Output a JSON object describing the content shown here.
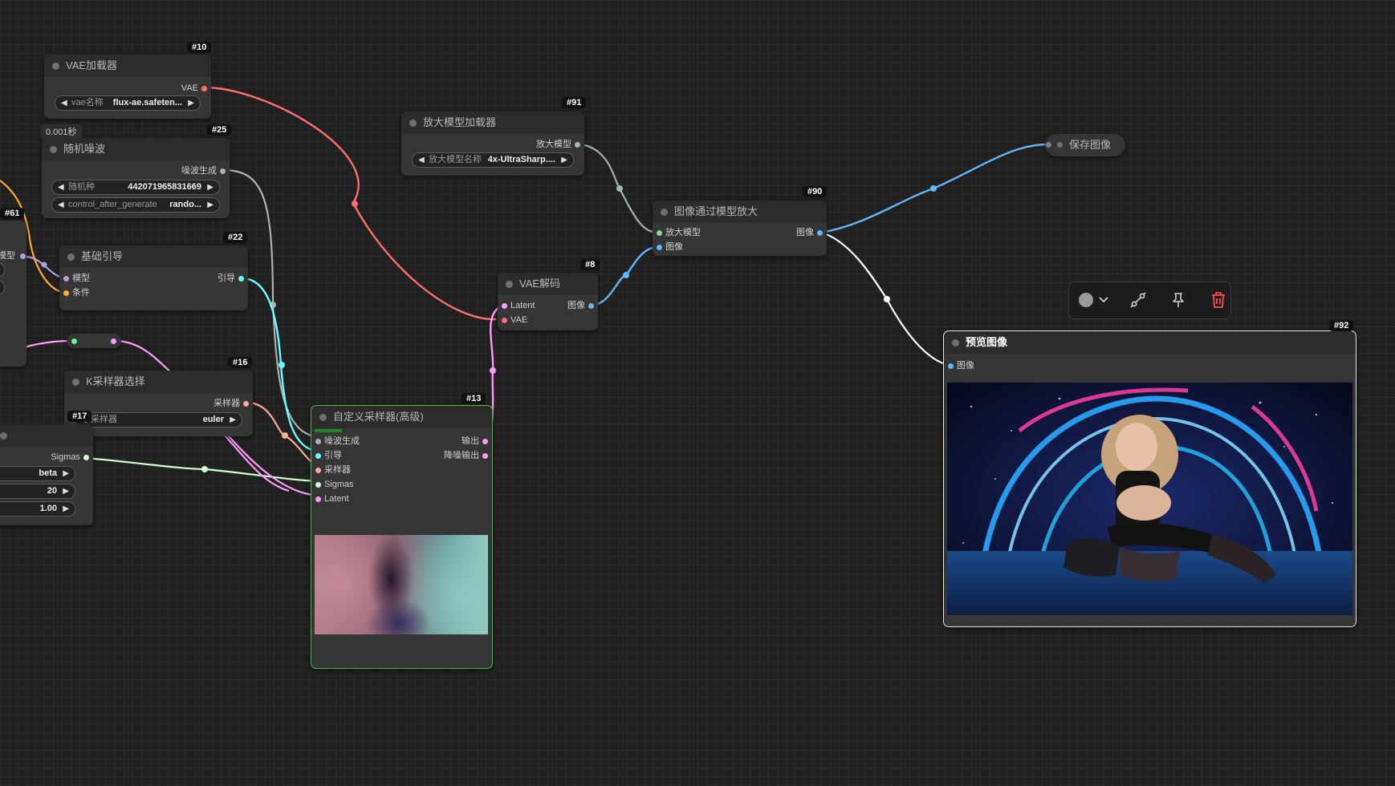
{
  "nodes": {
    "vae_loader": {
      "id": "#10",
      "title": "VAE加载器",
      "output": "VAE",
      "widget_label": "vae名称",
      "widget_value": "flux-ae.safeten..."
    },
    "noise": {
      "id": "#25",
      "title": "随机噪波",
      "time": "0.001秒",
      "output": "噪波生成",
      "seed_label": "随机种",
      "seed_value": "442071965831669",
      "cag_label": "control_after_generate",
      "cag_value": "rando..."
    },
    "upscale_loader": {
      "id": "#91",
      "title": "放大模型加载器",
      "output": "放大模型",
      "widget_label": "放大模型名称",
      "widget_value": "4x-UltraSharp...."
    },
    "upscale": {
      "id": "#90",
      "title": "图像通过模型放大",
      "in_model": "放大模型",
      "in_image": "图像",
      "output": "图像"
    },
    "save": {
      "title": "保存图像"
    },
    "guider": {
      "id": "#22",
      "title": "基础引导",
      "in_model": "模型",
      "in_cond": "条件",
      "output": "引导"
    },
    "vae_decode": {
      "id": "#8",
      "title": "VAE解码",
      "in_latent": "Latent",
      "in_vae": "VAE",
      "output": "图像"
    },
    "ksampler_select": {
      "id": "#16",
      "title": "K采样器选择",
      "output": "采样器",
      "widget_label": "采样器",
      "widget_value": "euler"
    },
    "custom_sampler": {
      "id": "#13",
      "title": "自定义采样器(高级)",
      "in_noise": "噪波生成",
      "in_guider": "引导",
      "in_sampler": "采样器",
      "in_sigmas": "Sigmas",
      "in_latent": "Latent",
      "out_output": "输出",
      "out_denoised": "降噪输出"
    },
    "scheduler": {
      "id": "#17",
      "output": "Sigmas",
      "w1_value": "beta",
      "w2_value": "20",
      "w3_value": "1.00"
    },
    "partial61": {
      "id": "#61",
      "out_label": "模型"
    },
    "preview": {
      "id": "#92",
      "title": "预览图像",
      "in_image": "图像"
    }
  },
  "toolbar": {
    "color_icon": "color-circle-icon",
    "bypass_icon": "bypass-icon",
    "pin_icon": "pin-icon",
    "delete_icon": "trash-icon"
  },
  "colors": {
    "vae": "#ff6e6e",
    "noise": "#b0b0b0",
    "guider": "#66ffff",
    "sampler": "#ffaa99",
    "sigmas": "#ccffcc",
    "latent": "#ff9cf9",
    "image": "#64b5f6",
    "upscale_model": "#a0b8a0",
    "conditioning": "#ffa931",
    "model": "#b39ddb",
    "selected_border": "#3fbf3f"
  }
}
